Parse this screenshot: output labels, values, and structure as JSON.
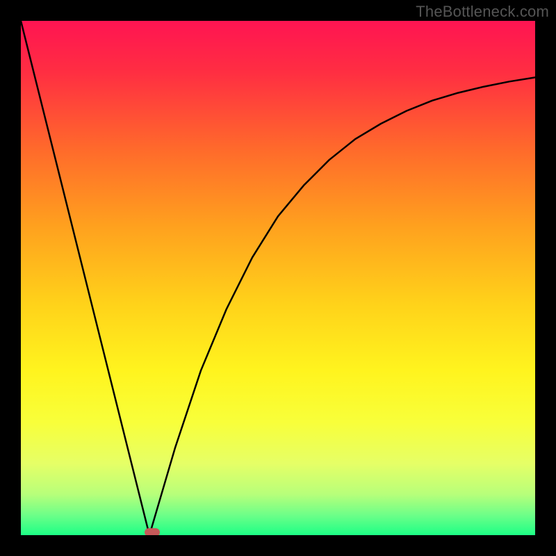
{
  "watermark": "TheBottleneck.com",
  "chart_data": {
    "type": "line",
    "title": "",
    "xlabel": "",
    "ylabel": "",
    "xlim": [
      0,
      100
    ],
    "ylim": [
      0,
      100
    ],
    "grid": false,
    "background": "rainbow-vertical-gradient",
    "series": [
      {
        "name": "left-slope",
        "x": [
          0,
          25
        ],
        "y": [
          100,
          0
        ]
      },
      {
        "name": "right-curve",
        "x": [
          25,
          30,
          35,
          40,
          45,
          50,
          55,
          60,
          65,
          70,
          75,
          80,
          85,
          90,
          95,
          100
        ],
        "y": [
          0,
          17,
          32,
          44,
          54,
          62,
          68,
          73,
          77,
          80,
          82.5,
          84.5,
          86,
          87.2,
          88.2,
          89
        ]
      }
    ],
    "markers": [
      {
        "name": "bottleneck-point",
        "x": 25.5,
        "y": 0.5,
        "color": "#c55a5a"
      }
    ],
    "gradient_stops": [
      {
        "offset": 0.0,
        "color": "#ff1452"
      },
      {
        "offset": 0.1,
        "color": "#ff2e42"
      },
      {
        "offset": 0.25,
        "color": "#ff6a2b"
      },
      {
        "offset": 0.4,
        "color": "#ffa11e"
      },
      {
        "offset": 0.55,
        "color": "#ffd21a"
      },
      {
        "offset": 0.68,
        "color": "#fff41e"
      },
      {
        "offset": 0.78,
        "color": "#f8ff3a"
      },
      {
        "offset": 0.86,
        "color": "#e6ff66"
      },
      {
        "offset": 0.92,
        "color": "#b8ff7a"
      },
      {
        "offset": 0.96,
        "color": "#6fff88"
      },
      {
        "offset": 1.0,
        "color": "#1dff86"
      }
    ]
  }
}
